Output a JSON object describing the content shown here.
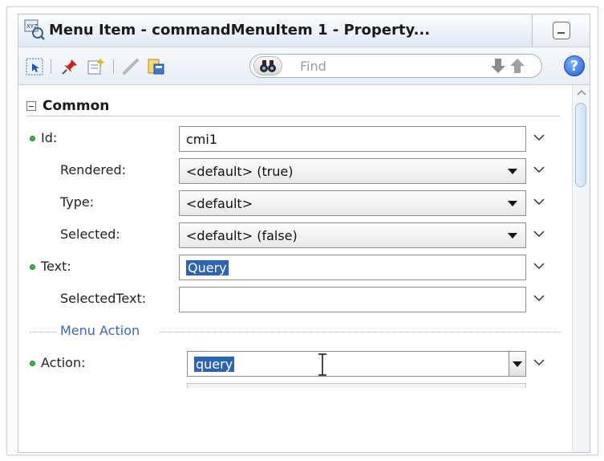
{
  "window": {
    "title": "Menu Item - commandMenuItem 1 - Property..."
  },
  "toolbar": {
    "find_placeholder": "Find",
    "help_label": "?"
  },
  "section": {
    "title": "Common"
  },
  "properties": [
    {
      "label": "Id:",
      "value": "cmi1",
      "kind": "text",
      "required": true
    },
    {
      "label": "Rendered:",
      "value": "<default> (true)",
      "kind": "combo",
      "required": false
    },
    {
      "label": "Type:",
      "value": "<default>",
      "kind": "combo",
      "required": false
    },
    {
      "label": "Selected:",
      "value": "<default> (false)",
      "kind": "combo",
      "required": false
    },
    {
      "label": "Text:",
      "value": "Query",
      "kind": "text",
      "required": true,
      "selected": true
    },
    {
      "label": "SelectedText:",
      "value": "",
      "kind": "text",
      "required": false
    }
  ],
  "group": {
    "label": "Menu Action"
  },
  "action": {
    "label": "Action:",
    "value": "query",
    "required": true,
    "selected": true
  },
  "colors": {
    "required_dot": "#39b54a",
    "selection": "#2d63b5",
    "group_label": "#3967b8"
  }
}
